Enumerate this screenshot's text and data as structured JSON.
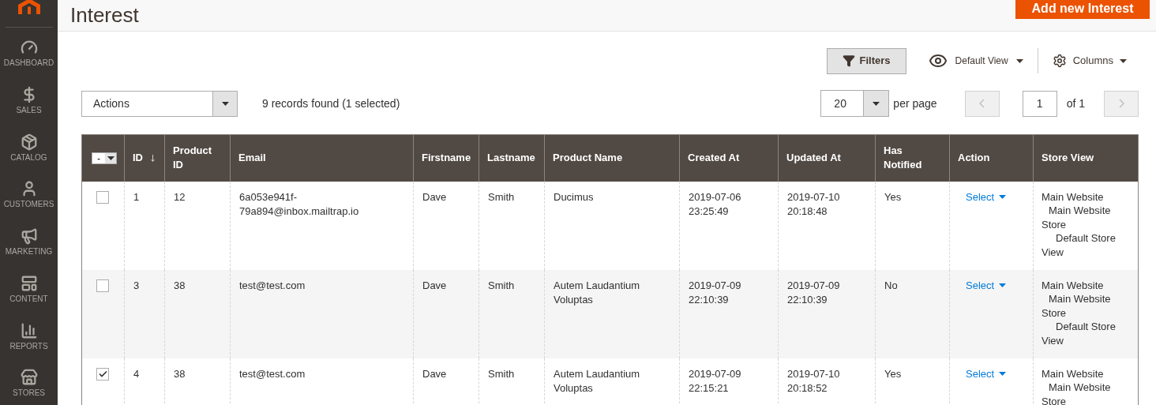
{
  "sidebar": {
    "items": [
      {
        "kind": "dashboard",
        "label": "DASHBOARD"
      },
      {
        "kind": "sales",
        "label": "SALES"
      },
      {
        "kind": "catalog",
        "label": "CATALOG"
      },
      {
        "kind": "customers",
        "label": "CUSTOMERS"
      },
      {
        "kind": "marketing",
        "label": "MARKETING"
      },
      {
        "kind": "content",
        "label": "CONTENT"
      },
      {
        "kind": "reports",
        "label": "REPORTS"
      },
      {
        "kind": "stores",
        "label": "STORES"
      }
    ]
  },
  "page": {
    "title": "Interest",
    "add_button": "Add new Interest"
  },
  "mass_select": "-",
  "toolbar": {
    "filters": "Filters",
    "view": "Default View",
    "columns": "Columns"
  },
  "actions": {
    "label": "Actions",
    "records": "9 records found (1 selected)"
  },
  "pager": {
    "per_page_value": "20",
    "per_page_label": "per page",
    "page": "1",
    "of": "of 1"
  },
  "table": {
    "columns": [
      "ID",
      "Product ID",
      "Email",
      "Firstname",
      "Lastname",
      "Product Name",
      "Created At",
      "Updated At",
      "Has Notified",
      "Action",
      "Store View"
    ],
    "rows": [
      {
        "checked": false,
        "cells": [
          "1",
          "12",
          "6a053e941f-79a894@inbox.mailtrap.io",
          "Dave",
          "Smith",
          "Ducimus",
          "2019-07-06 23:25:49",
          "2019-07-10 20:18:48",
          "Yes"
        ],
        "action": "Select",
        "store_view": [
          "Main Website",
          "Main Website Store",
          "Default Store View"
        ]
      },
      {
        "checked": false,
        "cells": [
          "3",
          "38",
          "test@test.com",
          "Dave",
          "Smith",
          "Autem Laudantium Voluptas",
          "2019-07-09 22:10:39",
          "2019-07-09 22:10:39",
          "No"
        ],
        "action": "Select",
        "store_view": [
          "Main Website",
          "Main Website Store",
          "Default Store View"
        ]
      },
      {
        "checked": true,
        "cells": [
          "4",
          "38",
          "test@test.com",
          "Dave",
          "Smith",
          "Autem Laudantium Voluptas",
          "2019-07-09 22:15:21",
          "2019-07-10 20:18:52",
          "Yes"
        ],
        "action": "Select",
        "store_view": [
          "Main Website",
          "Main Website Store"
        ]
      }
    ]
  }
}
